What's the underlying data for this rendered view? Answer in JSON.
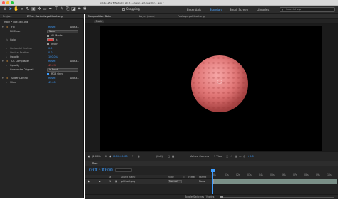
{
  "window": {
    "title": "Adobe After Effects CC 2017 - /Users/...ect-opacity/... .aep *"
  },
  "toolbar": {
    "snapping_label": "Snapping",
    "workspaces": [
      "Essentials",
      "Standard",
      "Small Screen",
      "Libraries"
    ],
    "active_workspace": "Standard",
    "search_placeholder": "Search Help"
  },
  "left_panel": {
    "tabs": [
      "Project",
      "Effect Controls golf-ball.png"
    ],
    "breadcrumb": "Main • golf-ball.png",
    "rows": {
      "fill_name": "Fill",
      "fill_reset": "Reset",
      "fill_about": "About...",
      "fill_mask": "Fill Mask",
      "fill_mask_value": "None",
      "all_masks": "All Masks",
      "color": "Color",
      "invert": "Invert",
      "h_feather": "Horizontal Feather",
      "h_feather_value": "0.0",
      "v_feather": "Vertical Feather",
      "v_feather_value": "0.0",
      "opacity": "Opacity",
      "opacity_value": "100.0%",
      "cc_composite": "CC Composite",
      "cc_reset": "Reset",
      "cc_about": "About...",
      "cc_opacity": "Opacity",
      "cc_opacity_value": "45.0%",
      "composite_original": "Composite Original",
      "composite_value": "In Front",
      "rgb_only": "RGB Only",
      "slider_control": "Slider Control",
      "slider_reset": "Reset",
      "slider_about": "About...",
      "slider": "Slider",
      "slider_value": "45.00"
    }
  },
  "comp_panel": {
    "tabs": [
      "Composition Main",
      "Layer (none)",
      "Footage golf-ball.png"
    ],
    "breadcrumb": "Main",
    "bottom_bar": {
      "zoom": "(100%)",
      "timecode": "0:00:00:00",
      "resolution": "(Full)",
      "camera": "Active Camera",
      "views": "1 View",
      "exposure": "+0.0"
    }
  },
  "timeline": {
    "tab": "Main",
    "timecode": "0:00:00:00",
    "columns": [
      "#",
      "Source Name",
      "Mode",
      "T",
      "TrkMat",
      "Parent"
    ],
    "layer": {
      "index": "1",
      "name": "golf-ball.png",
      "mode": "Normal",
      "parent": "None"
    },
    "ruler_ticks": [
      "0s",
      "01s",
      "02s",
      "03s",
      "04s",
      "05s",
      "06s",
      "07s",
      "08s",
      "09s",
      "10s"
    ],
    "footer": "Toggle Switches / Modes"
  },
  "colors": {
    "accent": "#3d9dff",
    "fill_color": "#e03a3a",
    "ball_tint": "#e27878"
  }
}
